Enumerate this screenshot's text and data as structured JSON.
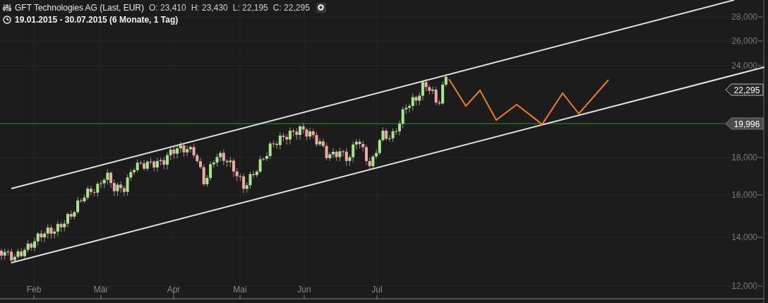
{
  "header": {
    "title": "GFT Technologies AG (Last, EUR)",
    "quotes": [
      "O: 23,410",
      "H: 23,430",
      "L: 22,195",
      "C: 22,295"
    ],
    "date_range": "19.01.2015 - 30.07.2015 (6 Monate, 1 Tag)"
  },
  "y_axis": {
    "labels": [
      "28,000",
      "26,000",
      "24,000",
      "18,000",
      "16,000",
      "14,000",
      "12,000"
    ]
  },
  "x_axis": {
    "labels": [
      "Feb",
      "Mär",
      "Apr",
      "Mai",
      "Jun",
      "Jul"
    ]
  },
  "price_tags": [
    {
      "text": "22,295",
      "kind": "last"
    },
    {
      "text": "19,996",
      "kind": "level"
    }
  ]
}
